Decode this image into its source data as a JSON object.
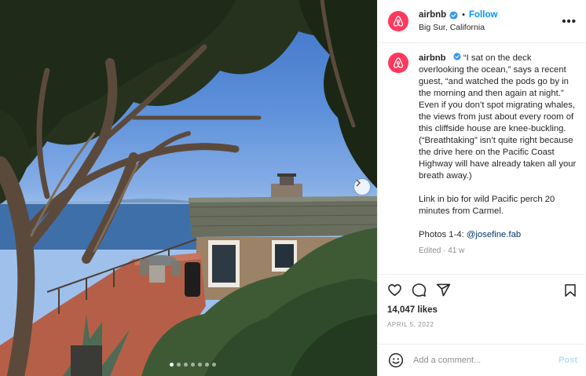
{
  "post": {
    "username": "airbnb",
    "follow_label": "Follow",
    "separator": "•",
    "location": "Big Sur, California",
    "more_label": "•••"
  },
  "caption": {
    "username": "airbnb",
    "body": "“I sat on the deck overlooking the ocean,” says a recent guest, “and watched the pods go by in the morning and then again at night.” Even if you don’t spot migrating whales, the views from just about every room of this cliffside house are knee-buckling. (“Breathtaking” isn’t quite right because the drive here on the Pacific Coast Highway will have already taken all your breath away.)",
    "link_line": "Link in bio for wild Pacific perch 20 minutes from Carmel.",
    "photos_prefix": "Photos 1-4: ",
    "mention": "@josefine.fab",
    "edited": "Edited · 41 w"
  },
  "stats": {
    "likes": "14,047 likes",
    "date": "APRIL 5, 2022"
  },
  "comment_box": {
    "placeholder": "Add a comment...",
    "post_label": "Post"
  },
  "carousel": {
    "count": 7,
    "active_index": 0
  },
  "colors": {
    "brand": "#ff385c",
    "link": "#0095f6",
    "post_disabled": "#b3dffc",
    "verified": "#3897f0"
  },
  "icons": [
    "airbnb-logo-icon",
    "verified-badge-icon",
    "more-icon",
    "heart-icon",
    "comment-icon",
    "share-icon",
    "bookmark-icon",
    "emoji-icon",
    "next-arrow-icon"
  ]
}
